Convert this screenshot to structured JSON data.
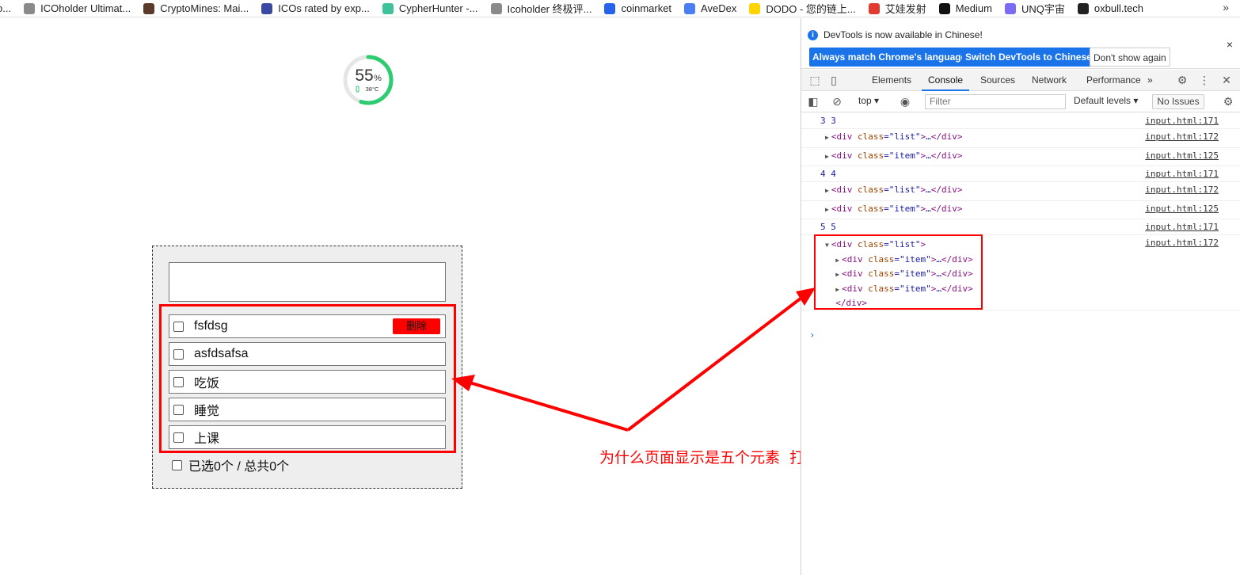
{
  "bookmarks": [
    {
      "label": "o...",
      "color": "#bbbbbb"
    },
    {
      "label": "ICOholder Ultimat...",
      "color": "#8a8a8a"
    },
    {
      "label": "CryptoMines: Mai...",
      "color": "#5a3a2a"
    },
    {
      "label": "ICOs rated by exp...",
      "color": "#3b4aa0"
    },
    {
      "label": "CypherHunter -...",
      "color": "#3fc29b"
    },
    {
      "label": "Icoholder 终极评...",
      "color": "#8a8a8a"
    },
    {
      "label": "coinmarket",
      "color": "#2563eb"
    },
    {
      "label": "AveDex",
      "color": "#4c7ef3"
    },
    {
      "label": "DODO - 您的链上...",
      "color": "#ffd400"
    },
    {
      "label": "艾娃发射",
      "color": "#e33a2f"
    },
    {
      "label": "Medium",
      "color": "#111111"
    },
    {
      "label": "UNQ宇宙",
      "color": "#7b6cf6"
    },
    {
      "label": "oxbull.tech",
      "color": "#222222"
    }
  ],
  "bookmarks_more": "»",
  "dial": {
    "value": 55,
    "percent_sign": "%",
    "temperature": "38°C",
    "accent": "#2ecc71"
  },
  "todo": {
    "input_value": "",
    "items": [
      {
        "label": "fsfdsg",
        "checked": false
      },
      {
        "label": "asfdsafsa",
        "checked": false
      },
      {
        "label": "吃饭",
        "checked": false
      },
      {
        "label": "睡觉",
        "checked": false
      },
      {
        "label": "上课",
        "checked": false
      }
    ],
    "delete_label": "删除",
    "summary": "已选0个 / 总共0个"
  },
  "annotation": {
    "question": "为什么页面显示是五个元素  打印出结果却是三个",
    "color": "#ff0000"
  },
  "devtools": {
    "banner_message": "DevTools is now available in Chinese!",
    "btn_match": "Always match Chrome's language",
    "btn_switch": "Switch DevTools to Chinese",
    "btn_dont_show": "Don't show again",
    "close": "×",
    "tabs": [
      "Elements",
      "Console",
      "Sources",
      "Network",
      "Performance"
    ],
    "active_tab": "Console",
    "tabs_more": "»",
    "context": "top",
    "filter_placeholder": "Filter",
    "levels": "Default levels",
    "issues": "No Issues",
    "logs": [
      {
        "kind": "text",
        "text": "3 3",
        "src": "input.html:171"
      },
      {
        "kind": "node",
        "cls": "list",
        "src": "input.html:172"
      },
      {
        "kind": "node",
        "cls": "item",
        "src": "input.html:125"
      },
      {
        "kind": "text",
        "text": "4 4",
        "src": "input.html:171"
      },
      {
        "kind": "node",
        "cls": "list",
        "src": "input.html:172"
      },
      {
        "kind": "node",
        "cls": "item",
        "src": "input.html:125"
      },
      {
        "kind": "text",
        "text": "5 5",
        "src": "input.html:171"
      },
      {
        "kind": "expanded",
        "cls": "list",
        "children": [
          "item",
          "item",
          "item"
        ],
        "src": "input.html:172"
      }
    ],
    "prompt": "›"
  }
}
